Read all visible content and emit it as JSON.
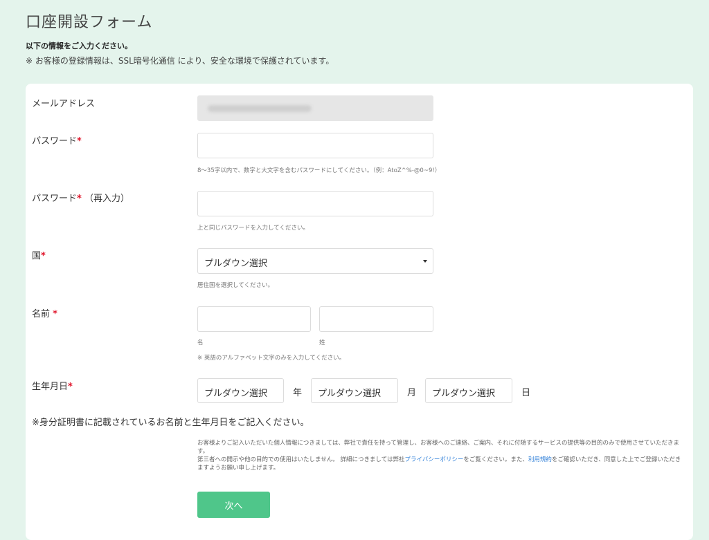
{
  "page": {
    "title": "口座開設フォーム",
    "lead": "以下の情報をご入力ください。",
    "security_note": "※ お客様の登録情報は、SSL暗号化通信 により、安全な環境で保護されています。"
  },
  "form": {
    "email": {
      "label": "メールアドレス"
    },
    "password": {
      "label": "パスワード",
      "required_mark": "*",
      "hint": "8～35字以内で、数字と大文字を含むパスワードにしてください。（例：AtoZ^%-@0~9!）"
    },
    "password_confirm": {
      "label": "パスワード",
      "required_mark": "*",
      "label_suffix": "（再入力）",
      "hint": "上と同じパスワードを入力してください。"
    },
    "country": {
      "label": "国",
      "required_mark": "*",
      "selected": "プルダウン選択",
      "hint": "居住国を選択してください。"
    },
    "name": {
      "label": "名前",
      "required_mark": "*",
      "first_caption": "名",
      "last_caption": "姓",
      "note": "※ 英語のアルファベット文字のみを入力してください。"
    },
    "birthdate": {
      "label": "生年月日",
      "required_mark": "*",
      "year_selected": "プルダウン選択",
      "year_unit": "年",
      "month_selected": "プルダウン選択",
      "month_unit": "月",
      "day_selected": "プルダウン選択",
      "day_unit": "日"
    },
    "id_note": "※身分証明書に記載されているお名前と生年月日をご記入ください。",
    "privacy": {
      "line1": "お客様よりご記入いただいた個人情報につきましては、弊社で責任を持って管理し、お客様へのご連絡、ご案内、それに付随するサービスの提供等の目的のみで使用させていただきます。",
      "line2_a": "第三者への開示や他の目的での使用はいたしません。 詳細につきましては弊社",
      "privacy_link": "プライバシーポリシー",
      "line2_b": "をご覧ください。また、",
      "terms_link": "利用規約",
      "line2_c": "をご確認いただき、同意した上でご登録いただきますようお願い申し上げます。"
    },
    "next_button": "次へ"
  }
}
